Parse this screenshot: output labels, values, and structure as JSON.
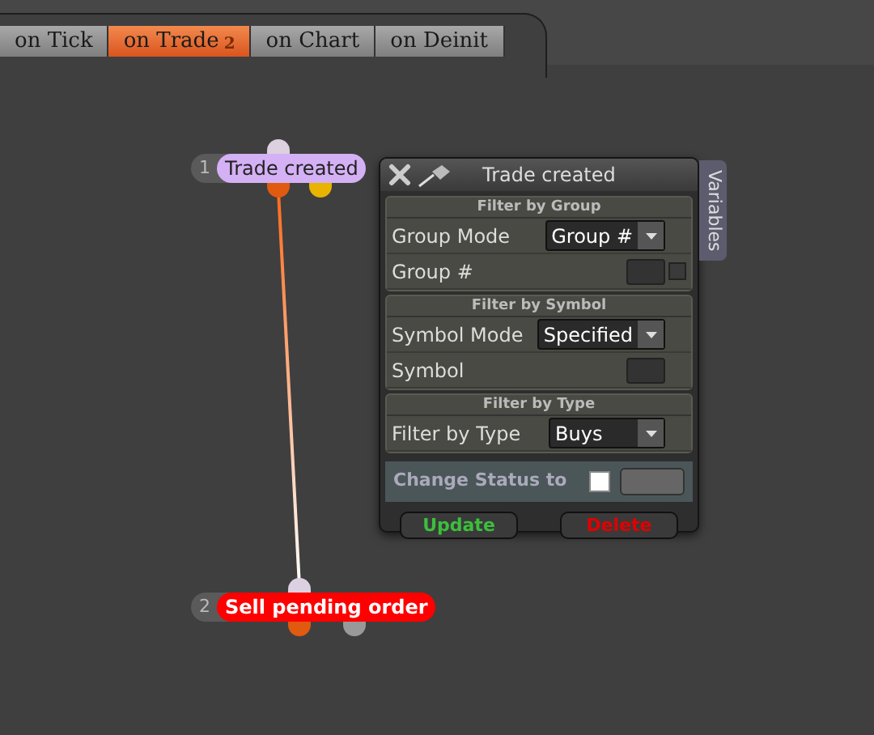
{
  "tabs": [
    {
      "label": "on Tick",
      "selected": false
    },
    {
      "label": "on Trade",
      "badge": "2",
      "selected": true
    },
    {
      "label": "on Chart",
      "selected": false
    },
    {
      "label": "on Deinit",
      "selected": false
    }
  ],
  "nodes": [
    {
      "number": "1",
      "label": "Trade created",
      "kind": "event",
      "color": "#d4b0f4"
    },
    {
      "number": "2",
      "label": "Sell pending order",
      "kind": "action",
      "color": "#ff0000"
    }
  ],
  "panel": {
    "title": "Trade created",
    "side_tab": "Variables",
    "sections": [
      {
        "title": "Filter by Group",
        "rows": [
          {
            "label": "Group Mode",
            "kind": "dropdown",
            "value": "Group #"
          },
          {
            "label": "Group #",
            "kind": "input",
            "checked": false
          }
        ]
      },
      {
        "title": "Filter by Symbol",
        "rows": [
          {
            "label": "Symbol Mode",
            "kind": "dropdown",
            "value": "Specified"
          },
          {
            "label": "Symbol",
            "kind": "input"
          }
        ]
      },
      {
        "title": "Filter by Type",
        "rows": [
          {
            "label": "Filter by Type",
            "kind": "dropdown",
            "value": "Buys"
          }
        ]
      }
    ],
    "change_status": {
      "label": "Change Status to",
      "checked": false
    },
    "buttons": [
      {
        "label": "Update",
        "kind": "confirm"
      },
      {
        "label": "Delete",
        "kind": "danger"
      }
    ]
  }
}
